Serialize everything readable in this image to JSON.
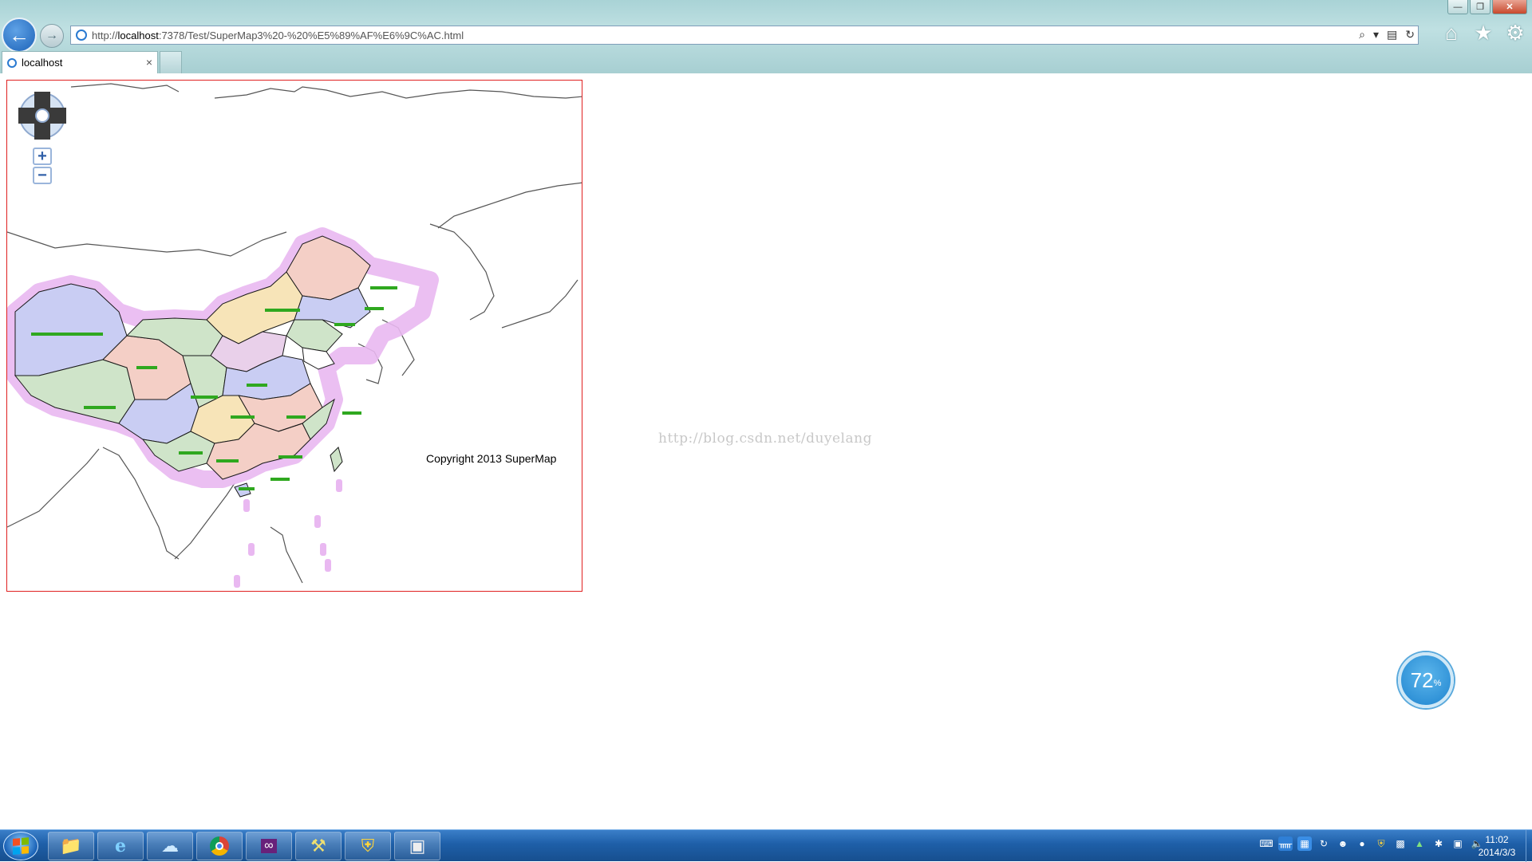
{
  "browser": {
    "url_prefix": "http://",
    "url_host": "localhost",
    "url_rest": ":7378/Test/SuperMap3%20-%20%E5%89%AF%E6%9C%AC.html",
    "tab_title": "localhost",
    "tab_close": "×",
    "window_controls": {
      "minimize": "—",
      "restore": "❐",
      "close": "✕"
    },
    "address_tools": {
      "search": "⌕",
      "dropdown": "▾",
      "compat": "▤",
      "refresh": "↻"
    },
    "toolbar_icons": {
      "home": "⌂",
      "favorites": "★",
      "settings": "⚙"
    }
  },
  "map": {
    "copyright": "Copyright 2013 SuperMap",
    "zoom_in": "+",
    "zoom_out": "−",
    "province_fill_colors": [
      "#c9cdf3",
      "#f4cfc6",
      "#cfe4c9",
      "#f7e4b8",
      "#e9d0ea"
    ],
    "region_halo_color": "#e9b8f1",
    "border_color": "#1a1a1a",
    "coastline_color": "#555555",
    "label_color": "#2fa81f"
  },
  "watermark": "http://blog.csdn.net/duyelang",
  "network_widget": {
    "value": "72",
    "unit": "%"
  },
  "taskbar": {
    "apps": [
      "file-explorer",
      "internet-explorer",
      "cloud-app",
      "chrome",
      "visual-studio",
      "tools-app",
      "security-app",
      "window-app"
    ],
    "clock_time": "11:02",
    "clock_date": "2014/3/3"
  }
}
